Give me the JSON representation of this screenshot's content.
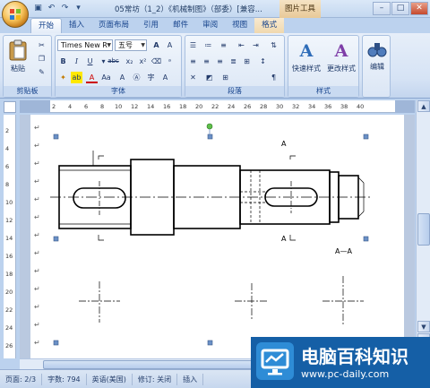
{
  "titlebar": {
    "title": "05常坊（1_2）《机械制图》（部委）[兼容...",
    "tool_tab_title": "图片工具"
  },
  "tabs": [
    "开始",
    "插入",
    "页面布局",
    "引用",
    "邮件",
    "审阅",
    "视图",
    "格式"
  ],
  "ribbon": {
    "clipboard": {
      "paste_label": "粘贴",
      "group_label": "剪贴板"
    },
    "font": {
      "font_name": "Times New R",
      "font_size": "五号",
      "group_label": "字体"
    },
    "paragraph": {
      "group_label": "段落"
    },
    "styles": {
      "quick_styles_label": "快速样式",
      "change_styles_label": "更改样式",
      "group_label": "样式"
    },
    "editing": {
      "edit_label": "编辑"
    }
  },
  "ruler": {
    "h_ticks": [
      "2",
      "4",
      "6",
      "8",
      "10",
      "12",
      "14",
      "16",
      "18",
      "20",
      "22",
      "24",
      "26",
      "28",
      "30",
      "32",
      "34",
      "36",
      "38",
      "40"
    ],
    "v_ticks": [
      "2",
      "4",
      "6",
      "8",
      "10",
      "12",
      "14",
      "16",
      "18",
      "20",
      "22",
      "24",
      "26"
    ]
  },
  "drawing": {
    "label_a_top": "A",
    "label_a_bottom": "A",
    "section_label": "A—A"
  },
  "statusbar": {
    "page": "页面: 2/3",
    "words": "字数: 794",
    "language": "英语(美国)",
    "revisions": "修订: 关闭",
    "insert": "插入"
  },
  "watermark": {
    "name": "电脑百科知识",
    "url": "www.pc-daily.com"
  }
}
